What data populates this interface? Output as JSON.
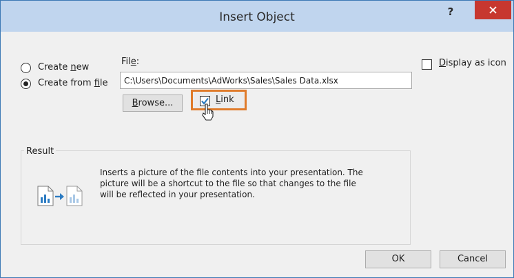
{
  "dialog": {
    "title": "Insert Object",
    "help_label": "?"
  },
  "options": {
    "create_new": {
      "pre": "Create ",
      "key": "n",
      "post": "ew",
      "selected": false
    },
    "create_from_file": {
      "pre": "Create from ",
      "key": "f",
      "post": "ile",
      "selected": true
    }
  },
  "file": {
    "label_pre": "Fil",
    "label_key": "e",
    "label_post": ":",
    "value": "C:\\Users\\Documents\\AdWorks\\Sales\\Sales Data.xlsx"
  },
  "browse": {
    "key": "B",
    "post": "rowse..."
  },
  "link": {
    "key": "L",
    "post": "ink",
    "checked": true
  },
  "display_as_icon": {
    "key": "D",
    "post": "isplay as icon",
    "checked": false
  },
  "result": {
    "label": "Result",
    "lines": [
      "Inserts a picture of the file contents into your presentation. The",
      "picture will be a shortcut to the file so that changes to the file",
      "will be reflected in your presentation."
    ]
  },
  "buttons": {
    "ok": "OK",
    "cancel": "Cancel"
  },
  "colors": {
    "titlebar": "#c0d5ee",
    "close": "#c7372f",
    "highlight": "#e07b2a",
    "icon_blue": "#2b7bc2"
  },
  "icons": [
    "close-icon",
    "checkmark-icon",
    "mouse-cursor-icon",
    "chart-document-icon",
    "arrow-right-icon"
  ]
}
